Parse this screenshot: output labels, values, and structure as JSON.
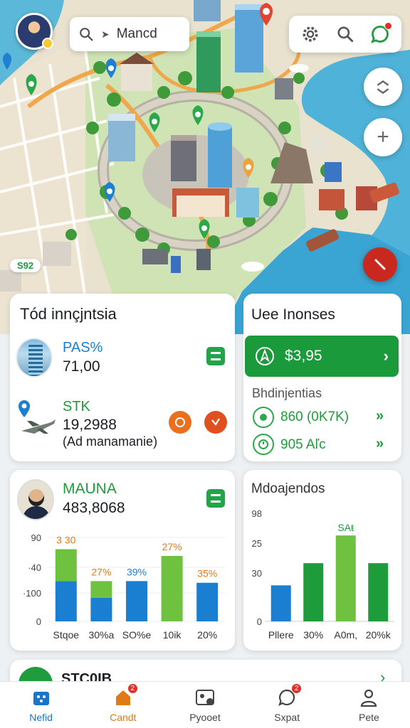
{
  "map": {
    "search": {
      "text": "Mancd",
      "arrow": "➤"
    },
    "tag_label": "S92",
    "zoom_in": "+",
    "icons": [
      "profile-avatar",
      "search-icon",
      "settings-gear-icon",
      "chat-icon",
      "layers-icon",
      "compass-icon"
    ]
  },
  "incidents_card": {
    "title": "Tód innçjntsia",
    "item1": {
      "label": "PAS%",
      "value": "71,00"
    },
    "item2": {
      "label": "STK",
      "value": "19,2988",
      "note": "(Ad manamanie)"
    }
  },
  "lines_card": {
    "title": "Uee Inonses",
    "button_value": "$3,95",
    "section": "Bhdinjentias",
    "row1": {
      "value": "860 (0K7K)",
      "arrow": "»"
    },
    "row2": {
      "value": "905 Aľc",
      "arrow": "»"
    }
  },
  "chart1_card": {
    "name": "MAUNA",
    "value": "483,8068"
  },
  "chart2_card": {
    "title": "Mdoajendos"
  },
  "chart_data": [
    {
      "type": "bar",
      "categories": [
        "Stqoe",
        "30%a",
        "SO%e",
        "10ik",
        "20%"
      ],
      "yticks": [
        "90",
        "·40",
        "·100",
        "0"
      ],
      "series": [
        {
          "values": [
            48,
            28,
            48,
            0,
            46
          ],
          "color": "#1a7fd0"
        },
        {
          "values": [
            38,
            20,
            0,
            78,
            0
          ],
          "color": "#6ec23f"
        }
      ],
      "data_labels": [
        "3 30",
        "27%",
        "39%",
        "27%",
        "35%"
      ],
      "ylim": [
        0,
        100
      ]
    },
    {
      "type": "bar",
      "categories": [
        "Pllere",
        "30%",
        "A0m,",
        "20%k"
      ],
      "yticks": [
        "98",
        "25",
        "30",
        "0"
      ],
      "values": [
        26,
        42,
        62,
        42
      ],
      "colors": [
        "#1a7fd0",
        "#1e9c3b",
        "#6ec23f",
        "#1e9c3b"
      ],
      "data_labels": [
        "",
        "",
        "SAŧ",
        ""
      ],
      "ylim": [
        0,
        78
      ]
    }
  ],
  "bottom_card": {
    "label": "STC0IB"
  },
  "nav": [
    {
      "label": "Nefid",
      "badge": "",
      "state": "active"
    },
    {
      "label": "Candt",
      "badge": "2",
      "state": "orange"
    },
    {
      "label": "Pyooet",
      "badge": "",
      "state": ""
    },
    {
      "label": "Sxpat",
      "badge": "2",
      "state": ""
    },
    {
      "label": "Pete",
      "badge": "",
      "state": ""
    }
  ],
  "colors": {
    "accent_green": "#1a9a3a",
    "accent_blue": "#1a7fd0",
    "orange": "#e07a17",
    "red": "#c8281e"
  }
}
